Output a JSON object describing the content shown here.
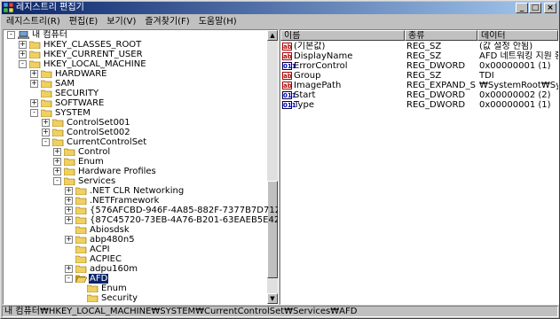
{
  "window": {
    "title": "레지스트리 편집기",
    "buttons": [
      "_",
      "□",
      "×"
    ]
  },
  "menu": [
    "레지스트리(R)",
    "편집(E)",
    "보기(V)",
    "즐겨찾기(F)",
    "도움말(H)"
  ],
  "tree": [
    {
      "label": "내 컴퓨터",
      "depth": 0,
      "exp": "-",
      "icon": "computer-icon"
    },
    {
      "label": "HKEY_CLASSES_ROOT",
      "depth": 1,
      "exp": "+"
    },
    {
      "label": "HKEY_CURRENT_USER",
      "depth": 1,
      "exp": "+"
    },
    {
      "label": "HKEY_LOCAL_MACHINE",
      "depth": 1,
      "exp": "-"
    },
    {
      "label": "HARDWARE",
      "depth": 2,
      "exp": "+"
    },
    {
      "label": "SAM",
      "depth": 2,
      "exp": "+"
    },
    {
      "label": "SECURITY",
      "depth": 2,
      "exp": ""
    },
    {
      "label": "SOFTWARE",
      "depth": 2,
      "exp": "+"
    },
    {
      "label": "SYSTEM",
      "depth": 2,
      "exp": "-"
    },
    {
      "label": "ControlSet001",
      "depth": 3,
      "exp": "+"
    },
    {
      "label": "ControlSet002",
      "depth": 3,
      "exp": "+"
    },
    {
      "label": "CurrentControlSet",
      "depth": 3,
      "exp": "-"
    },
    {
      "label": "Control",
      "depth": 4,
      "exp": "+"
    },
    {
      "label": "Enum",
      "depth": 4,
      "exp": "+"
    },
    {
      "label": "Hardware Profiles",
      "depth": 4,
      "exp": "+"
    },
    {
      "label": "Services",
      "depth": 4,
      "exp": "-"
    },
    {
      "label": ".NET CLR Networking",
      "depth": 5,
      "exp": "+"
    },
    {
      "label": ".NETFramework",
      "depth": 5,
      "exp": "+"
    },
    {
      "label": "{576AFCBD-946F-4A85-882F-7377B7D712CA}",
      "depth": 5,
      "exp": "+"
    },
    {
      "label": "{87C45720-73EB-4A76-B201-63EAEB5E42D6}",
      "depth": 5,
      "exp": "+"
    },
    {
      "label": "Abiosdsk",
      "depth": 5,
      "exp": ""
    },
    {
      "label": "abp480n5",
      "depth": 5,
      "exp": "+"
    },
    {
      "label": "ACPI",
      "depth": 5,
      "exp": ""
    },
    {
      "label": "ACPIEC",
      "depth": 5,
      "exp": ""
    },
    {
      "label": "adpu160m",
      "depth": 5,
      "exp": "+"
    },
    {
      "label": "AFD",
      "depth": 5,
      "exp": "-",
      "selected": true,
      "open": true
    },
    {
      "label": "Enum",
      "depth": 6,
      "exp": ""
    },
    {
      "label": "Security",
      "depth": 6,
      "exp": ""
    }
  ],
  "columns": [
    "이름",
    "종류",
    "데이터"
  ],
  "values": [
    {
      "name": "(기본값)",
      "type": "REG_SZ",
      "data": "(값 설정 안됨)",
      "kind": "sz"
    },
    {
      "name": "DisplayName",
      "type": "REG_SZ",
      "data": "AFD 네트워킹 지원 환경",
      "kind": "sz"
    },
    {
      "name": "ErrorControl",
      "type": "REG_DWORD",
      "data": "0x00000001 (1)",
      "kind": "dw"
    },
    {
      "name": "Group",
      "type": "REG_SZ",
      "data": "TDI",
      "kind": "sz"
    },
    {
      "name": "ImagePath",
      "type": "REG_EXPAND_SZ",
      "data": "₩SystemRoot₩System",
      "kind": "sz"
    },
    {
      "name": "Start",
      "type": "REG_DWORD",
      "data": "0x00000002 (2)",
      "kind": "dw"
    },
    {
      "name": "Type",
      "type": "REG_DWORD",
      "data": "0x00000001 (1)",
      "kind": "dw"
    }
  ],
  "status": "내 컴퓨터₩HKEY_LOCAL_MACHINE₩SYSTEM₩CurrentControlSet₩Services₩AFD",
  "colors": {
    "titlebar": "#0a246a",
    "selection": "#0a246a",
    "folder": "#f0d060"
  }
}
